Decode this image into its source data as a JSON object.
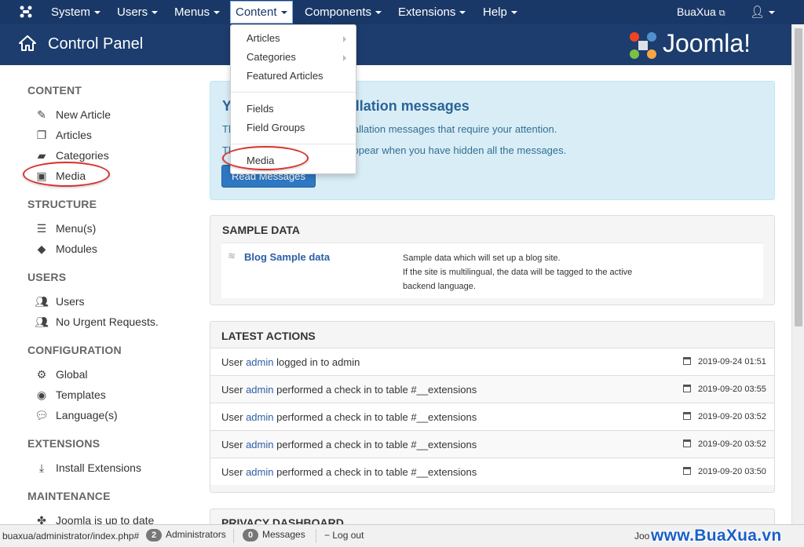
{
  "topnav": {
    "menus": [
      "System",
      "Users",
      "Menus",
      "Content",
      "Components",
      "Extensions",
      "Help"
    ],
    "site_name": "BuaXua"
  },
  "header": {
    "title": "Control Panel",
    "brand": "Joomla!"
  },
  "sidebar": {
    "sections": [
      {
        "title": "CONTENT",
        "items": [
          "New Article",
          "Articles",
          "Categories",
          "Media"
        ]
      },
      {
        "title": "STRUCTURE",
        "items": [
          "Menu(s)",
          "Modules"
        ]
      },
      {
        "title": "USERS",
        "items": [
          "Users",
          "No Urgent Requests."
        ]
      },
      {
        "title": "CONFIGURATION",
        "items": [
          "Global",
          "Templates",
          "Language(s)"
        ]
      },
      {
        "title": "EXTENSIONS",
        "items": [
          "Install Extensions"
        ]
      },
      {
        "title": "MAINTENANCE",
        "items": [
          "Joomla is up to date"
        ]
      }
    ]
  },
  "dropdown": {
    "items": [
      "Articles",
      "Categories",
      "Featured Articles",
      "Fields",
      "Field Groups",
      "Media"
    ]
  },
  "install_msg": {
    "title": "You have post-installation messages",
    "line1": "There are important post-installation messages that require your attention.",
    "line2": "This information area won't appear when you have hidden all the messages.",
    "button": "Read Messages"
  },
  "sample_data": {
    "heading": "SAMPLE DATA",
    "link": "Blog Sample data",
    "desc1": "Sample data which will set up a blog site.",
    "desc2": "If the site is multilingual, the data will be tagged to the active",
    "desc3": "backend language."
  },
  "latest": {
    "heading": "LATEST ACTIONS",
    "rows": [
      {
        "pre": "User ",
        "user": "admin",
        "post": " logged in to admin",
        "date": "2019-09-24 01:51"
      },
      {
        "pre": "User ",
        "user": "admin",
        "post": " performed a check in to table #__extensions",
        "date": "2019-09-20 03:55"
      },
      {
        "pre": "User ",
        "user": "admin",
        "post": " performed a check in to table #__extensions",
        "date": "2019-09-20 03:52"
      },
      {
        "pre": "User ",
        "user": "admin",
        "post": " performed a check in to table #__extensions",
        "date": "2019-09-20 03:52"
      },
      {
        "pre": "User ",
        "user": "admin",
        "post": " performed a check in to table #__extensions",
        "date": "2019-09-20 03:50"
      }
    ]
  },
  "privacy": {
    "heading": "PRIVACY DASHBOARD"
  },
  "statusbar": {
    "url": "buaxua/administrator/index.php#",
    "admins_count": "2",
    "admins_label": "Administrators",
    "messages_count": "0",
    "messages_label": "Messages",
    "logout": "Log out",
    "footer_partial": "Joo"
  },
  "watermark": "www.BuaXua.vn",
  "colors": {
    "nav_bg": "#1a3867",
    "header_bg": "#1c3d6e",
    "accent": "#2b5fa6",
    "highlight": "#d9322e",
    "button": "#2f78c4"
  }
}
